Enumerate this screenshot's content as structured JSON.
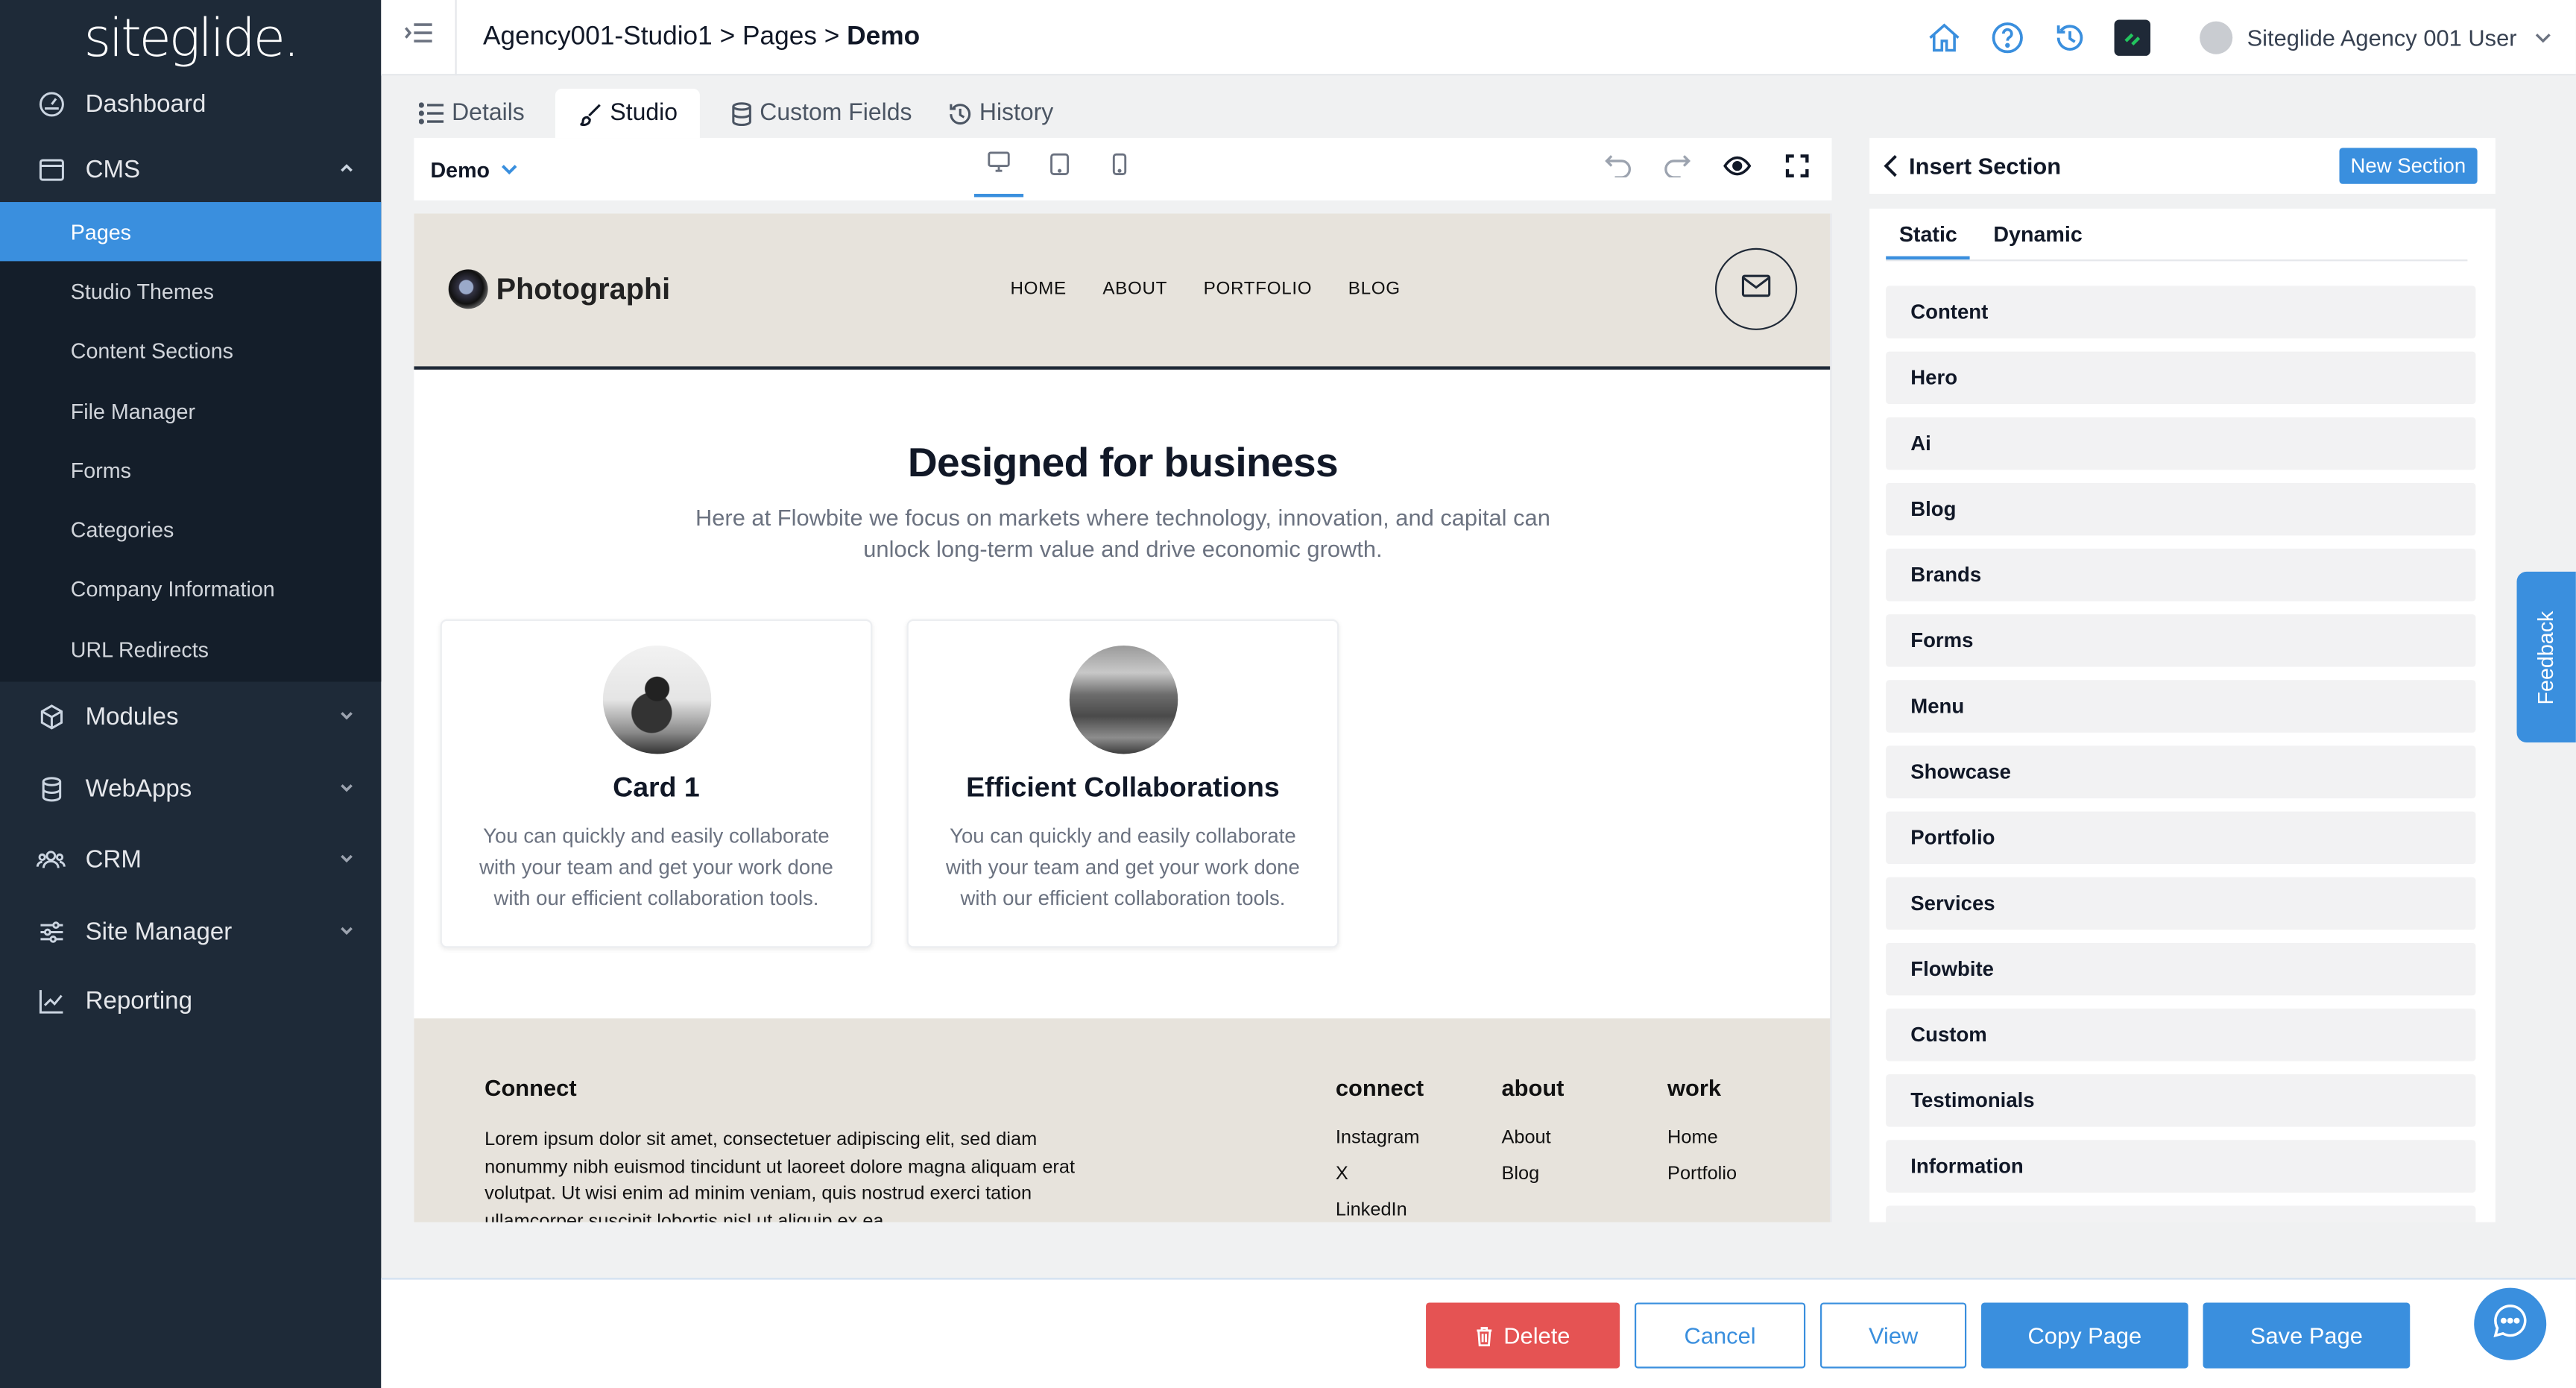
{
  "app": {
    "logo": "siteglide."
  },
  "sidebar": {
    "items": [
      {
        "label": "Dashboard",
        "icon": "gauge-icon"
      },
      {
        "label": "CMS",
        "icon": "browser-window-icon"
      },
      {
        "label": "Modules",
        "icon": "cube-icon"
      },
      {
        "label": "WebApps",
        "icon": "database-icon"
      },
      {
        "label": "CRM",
        "icon": "users-icon"
      },
      {
        "label": "Site Manager",
        "icon": "sliders-icon"
      },
      {
        "label": "Reporting",
        "icon": "chart-line-icon"
      }
    ],
    "cms_sub": [
      {
        "label": "Pages",
        "active": true
      },
      {
        "label": "Studio Themes"
      },
      {
        "label": "Content Sections"
      },
      {
        "label": "File Manager"
      },
      {
        "label": "Forms"
      },
      {
        "label": "Categories"
      },
      {
        "label": "Company Information"
      },
      {
        "label": "URL Redirects"
      }
    ]
  },
  "header": {
    "breadcrumb_prefix": "Agency001-Studio1 > Pages > ",
    "breadcrumb_current": "Demo",
    "user_name": "Siteglide Agency 001 User"
  },
  "tabs": [
    {
      "label": "Details",
      "icon": "list-icon"
    },
    {
      "label": "Studio",
      "icon": "brush-icon",
      "active": true
    },
    {
      "label": "Custom Fields",
      "icon": "database-icon"
    },
    {
      "label": "History",
      "icon": "history-icon"
    }
  ],
  "editor": {
    "page_name": "Demo"
  },
  "preview": {
    "brand": "Photographi",
    "nav": [
      "HOME",
      "ABOUT",
      "PORTFOLIO",
      "BLOG"
    ],
    "hero_title": "Designed for business",
    "hero_sub": "Here at Flowbite we focus on markets where technology, innovation, and capital can unlock long-term value and drive economic growth.",
    "cards": [
      {
        "title": "Card 1",
        "text": "You can quickly and easily collaborate with your team and get your work done with our efficient collaboration tools."
      },
      {
        "title": "Efficient Collaborations",
        "text": "You can quickly and easily collaborate with your team and get your work done with our efficient collaboration tools."
      }
    ],
    "footer": {
      "title": "Connect",
      "text": "Lorem ipsum dolor sit amet, consectetuer adipiscing elit, sed diam nonummy nibh euismod tincidunt ut laoreet dolore magna aliquam erat volutpat. Ut wisi enim ad minim veniam, quis nostrud exerci tation ullamcorper suscipit lobortis nisl ut aliquip ex ea",
      "columns": [
        {
          "title": "connect",
          "links": [
            "Instagram",
            "X",
            "LinkedIn"
          ]
        },
        {
          "title": "about",
          "links": [
            "About",
            "Blog"
          ]
        },
        {
          "title": "work",
          "links": [
            "Home",
            "Portfolio"
          ]
        }
      ]
    }
  },
  "panel": {
    "title": "Insert Section",
    "new_section": "New Section",
    "tabs": [
      "Static",
      "Dynamic"
    ],
    "sections": [
      "Content",
      "Hero",
      "Ai",
      "Blog",
      "Brands",
      "Forms",
      "Menu",
      "Showcase",
      "Portfolio",
      "Services",
      "Flowbite",
      "Custom",
      "Testimonials",
      "Information"
    ]
  },
  "feedback_label": "Feedback",
  "actions": {
    "delete": "Delete",
    "cancel": "Cancel",
    "view": "View",
    "copy": "Copy Page",
    "save": "Save Page"
  },
  "colors": {
    "accent": "#3a8fde",
    "danger": "#e55353",
    "sidebar": "#1e2a38"
  }
}
